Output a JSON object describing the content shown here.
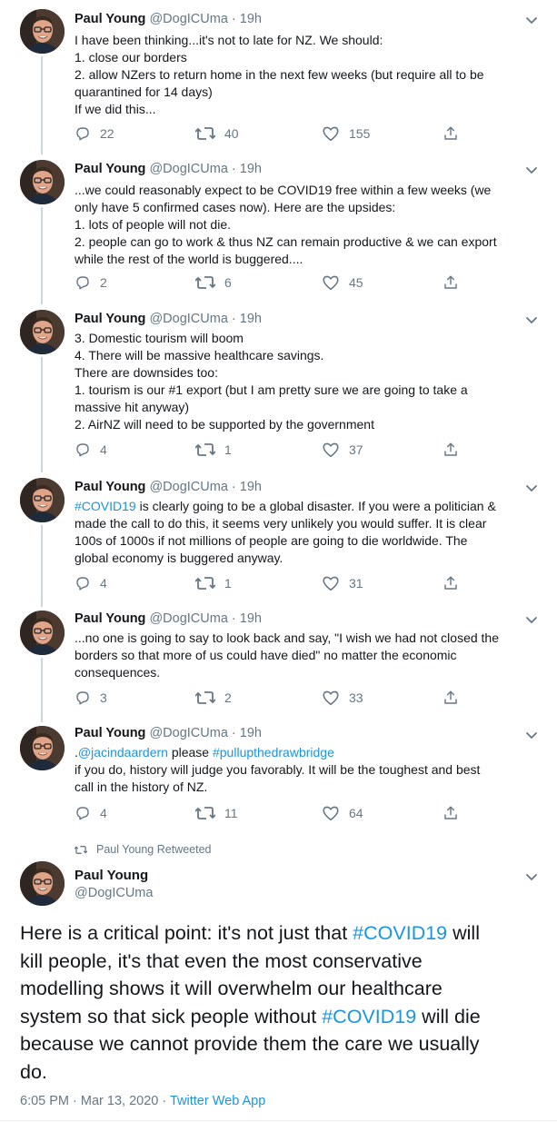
{
  "tweets": [
    {
      "name": "Paul Young",
      "handle": "@DogICUma",
      "time": "19h",
      "lines": [
        [
          {
            "t": "I have been thinking...it's not to late for NZ.  We should:"
          }
        ],
        [
          {
            "t": "1. close our borders"
          }
        ],
        [
          {
            "t": "2.  allow NZers to return home in the next few weeks (but require all to be"
          }
        ],
        [
          {
            "t": "quarantined for 14 days)"
          }
        ],
        [
          {
            "t": "If we did this..."
          }
        ]
      ],
      "replies": "22",
      "retweets": "40",
      "likes": "155"
    },
    {
      "name": "Paul Young",
      "handle": "@DogICUma",
      "time": "19h",
      "lines": [
        [
          {
            "t": "...we could reasonably expect to be COVID19 free within a few weeks (we"
          }
        ],
        [
          {
            "t": "only have 5 confirmed cases now).  Here are the upsides:"
          }
        ],
        [
          {
            "t": "1.  lots of people will not die."
          }
        ],
        [
          {
            "t": "2.  people can go to work & thus NZ can remain productive & we can export"
          }
        ],
        [
          {
            "t": "while the rest of the world is buggered...."
          }
        ]
      ],
      "replies": "2",
      "retweets": "6",
      "likes": "45"
    },
    {
      "name": "Paul Young",
      "handle": "@DogICUma",
      "time": "19h",
      "lines": [
        [
          {
            "t": "3.  Domestic tourism will boom"
          }
        ],
        [
          {
            "t": "4.  There will be massive healthcare savings."
          }
        ],
        [
          {
            "t": "There are downsides too:"
          }
        ],
        [
          {
            "t": "1.  tourism is our #1 export (but I am pretty sure we are going to take a"
          }
        ],
        [
          {
            "t": "massive hit anyway)"
          }
        ],
        [
          {
            "t": "2.  AirNZ will need to be supported by the government"
          }
        ]
      ],
      "replies": "4",
      "retweets": "1",
      "likes": "37"
    },
    {
      "name": "Paul Young",
      "handle": "@DogICUma",
      "time": "19h",
      "lines": [
        [
          {
            "t": "#COVID19",
            "link": true
          },
          {
            "t": " is clearly going to be a global disaster.  If you were a politician &"
          }
        ],
        [
          {
            "t": "made the call to do this, it seems very unlikely you would suffer. It is clear"
          }
        ],
        [
          {
            "t": "100s of 1000s if not  millions of people are going to die worldwide.  The"
          }
        ],
        [
          {
            "t": "global economy is buggered anyway."
          }
        ]
      ],
      "replies": "4",
      "retweets": "1",
      "likes": "31"
    },
    {
      "name": "Paul Young",
      "handle": "@DogICUma",
      "time": "19h",
      "lines": [
        [
          {
            "t": "...no one is going to say to look back and say, \"I wish we had not closed the"
          }
        ],
        [
          {
            "t": "borders so that more of us could have died\" no matter the economic"
          }
        ],
        [
          {
            "t": "consequences."
          }
        ]
      ],
      "replies": "3",
      "retweets": "2",
      "likes": "33"
    },
    {
      "name": "Paul Young",
      "handle": "@DogICUma",
      "time": "19h",
      "lines": [
        [
          {
            "t": "."
          },
          {
            "t": "@jacindaardern",
            "link": true
          },
          {
            "t": " please "
          },
          {
            "t": "#pullupthedrawbridge",
            "link": true
          }
        ],
        [
          {
            "t": "if you do, history will judge you favorably.  It will be the toughest and best"
          }
        ],
        [
          {
            "t": "call in the history of NZ."
          }
        ]
      ],
      "replies": "4",
      "retweets": "11",
      "likes": "64"
    }
  ],
  "retweet_context": "Paul Young Retweeted",
  "main_tweet": {
    "name": "Paul Young",
    "handle": "@DogICUma",
    "lines": [
      [
        {
          "t": "Here is a critical point: it's not just that "
        },
        {
          "t": "#COVID19",
          "link": true
        },
        {
          "t": " will"
        }
      ],
      [
        {
          "t": "kill people, it's that even the most conservative"
        }
      ],
      [
        {
          "t": "modelling shows it will overwhelm our healthcare"
        }
      ],
      [
        {
          "t": "system so that sick people without "
        },
        {
          "t": "#COVID19",
          "link": true
        },
        {
          "t": " will die"
        }
      ],
      [
        {
          "t": "because we cannot provide them the care we usually"
        }
      ],
      [
        {
          "t": "do."
        }
      ]
    ],
    "time": "6:05 PM",
    "date": "Mar 13, 2020",
    "app": "Twitter Web App"
  },
  "icons": {
    "reply": "reply-icon",
    "retweet": "retweet-icon",
    "like": "heart-icon",
    "share": "share-icon",
    "menu": "chevron-down-icon"
  },
  "colors": {
    "link": "#1b95e0",
    "muted": "#657786",
    "text": "#14171a",
    "thread_line": "#ccd6dd"
  }
}
